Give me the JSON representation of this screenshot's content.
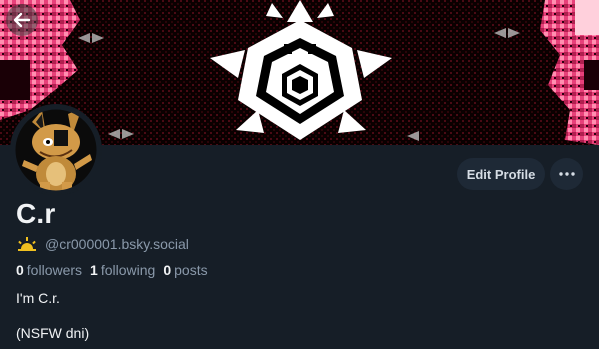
{
  "header": {
    "back_icon": "arrow-left-icon"
  },
  "profile": {
    "display_name": "C.r",
    "handle": "@cr000001.bsky.social",
    "handle_icon": "sun-icon",
    "edit_label": "Edit Profile",
    "more_icon": "ellipsis-icon",
    "stats": {
      "followers_count": "0",
      "followers_label": "followers",
      "following_count": "1",
      "following_label": "following",
      "posts_count": "0",
      "posts_label": "posts"
    },
    "bio_line1": "I'm C.r.",
    "bio_line2": "(NSFW dni)"
  },
  "colors": {
    "background": "#161e27",
    "button_bg": "#1e2936",
    "muted_text": "#8a99aa",
    "handle_icon": "#f0c020"
  }
}
